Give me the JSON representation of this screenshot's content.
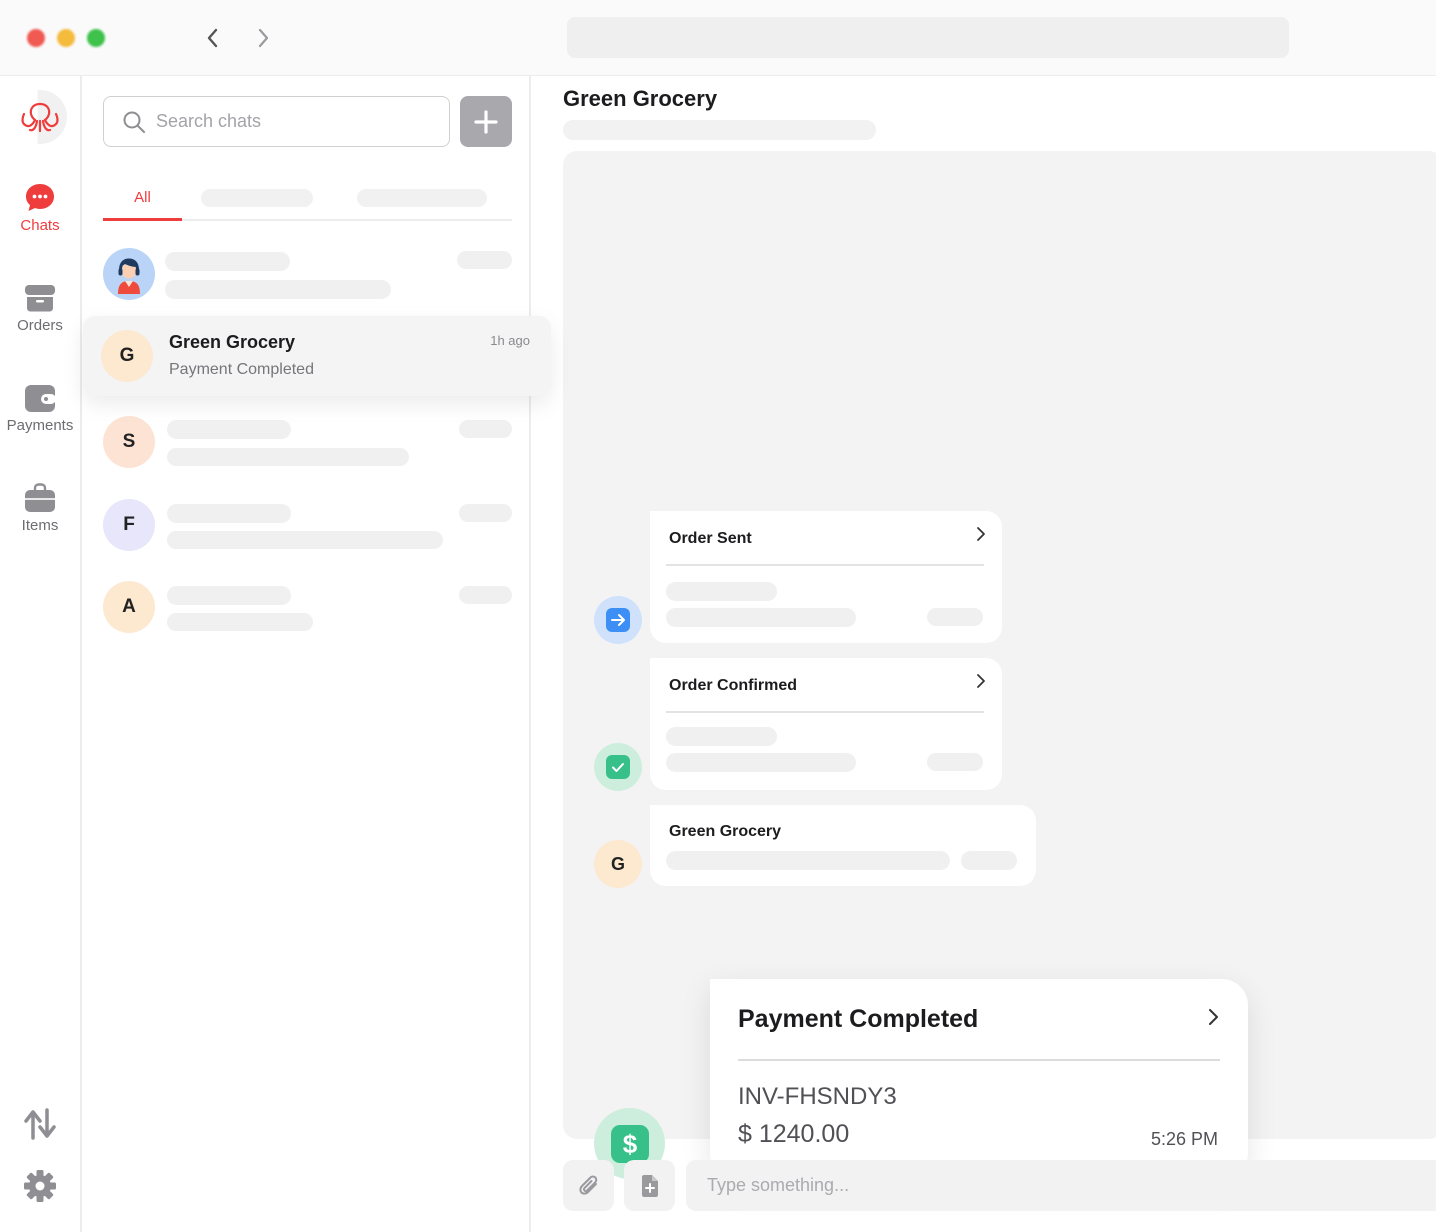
{
  "window": {
    "controls": [
      "close",
      "minimize",
      "maximize"
    ],
    "nav": {
      "back_icon": "chevron-left-icon",
      "forward_icon": "chevron-right-icon"
    }
  },
  "rail": {
    "logo_icon": "octopus-logo-icon",
    "items": [
      {
        "label": "Chats",
        "icon": "chat-bubble-icon",
        "active": true
      },
      {
        "label": "Orders",
        "icon": "archive-box-icon",
        "active": false
      },
      {
        "label": "Payments",
        "icon": "wallet-icon",
        "active": false
      },
      {
        "label": "Items",
        "icon": "bag-icon",
        "active": false
      }
    ],
    "bottom_icons": [
      "sort-arrows-icon",
      "gear-icon"
    ]
  },
  "list": {
    "search_placeholder": "Search chats",
    "add_icon": "plus-icon",
    "tabs": [
      {
        "label": "All",
        "active": true
      }
    ],
    "chats": [
      {
        "avatar_type": "image",
        "avatar_icon": "support-agent-icon"
      },
      {
        "avatar_letter": "G",
        "name": "Green Grocery",
        "preview": "Payment Completed",
        "time": "1h ago",
        "selected": true
      },
      {
        "avatar_letter": "S"
      },
      {
        "avatar_letter": "F"
      },
      {
        "avatar_letter": "A"
      }
    ]
  },
  "conversation": {
    "title": "Green Grocery",
    "messages": [
      {
        "type": "event",
        "title": "Order Sent",
        "icon": "arrow-right-icon"
      },
      {
        "type": "event",
        "title": "Order Confirmed",
        "icon": "check-icon"
      },
      {
        "type": "message",
        "title": "Green Grocery",
        "avatar_letter": "G"
      }
    ],
    "payment": {
      "title": "Payment Completed",
      "invoice": "INV-FHSNDY3",
      "amount": "$ 1240.00",
      "time": "5:26 PM",
      "icon": "dollar-icon"
    },
    "composer": {
      "placeholder": "Type something...",
      "attach_icon": "paperclip-icon",
      "file_icon": "file-add-icon"
    }
  },
  "colors": {
    "accent": "#ef3c3c",
    "blue_icon": "#3d8ef5",
    "green_icon": "#37c08a",
    "avatar_orange": "#fde8d0",
    "avatar_purple": "#e7e6fb",
    "avatar_peach": "#fde3d3"
  }
}
